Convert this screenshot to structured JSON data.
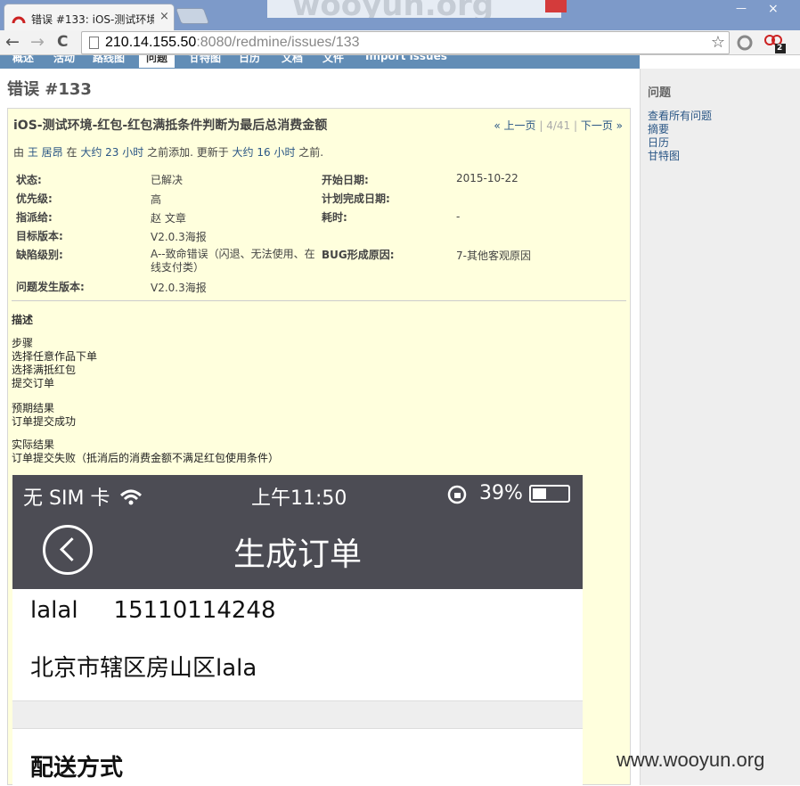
{
  "browser": {
    "tab_title": "错误 #133: iOS-测试环境",
    "tab_close": "×",
    "bg_logo_text": "wooyun.org",
    "minimize": "—",
    "close": "×",
    "url_host": "210.14.155.50",
    "url_rest": ":8080/redmine/issues/133",
    "nav_back": "←",
    "nav_forward": "→",
    "nav_reload": "C",
    "star": "☆",
    "ext_badge": "2"
  },
  "menu": [
    "概述",
    "活动",
    "路线图",
    "问题",
    "甘特图",
    "日历",
    "文档",
    "文件",
    "Import issues"
  ],
  "page": {
    "heading": "错误 #133"
  },
  "issue": {
    "subject": "iOS-测试环境-红包-红包满抵条件判断为最后总消费金额",
    "prev": "« 上一页",
    "position": "4/41",
    "next": "下一页 »",
    "by": "由",
    "author": "王 居昂",
    "at": "在",
    "created": "大约 23 小时",
    "added": "之前添加. 更新于",
    "updated": "大约 16 小时",
    "before": "之前.",
    "attributes": {
      "status_label": "状态:",
      "status": "已解决",
      "start_label": "开始日期:",
      "start": "2015-10-22",
      "priority_label": "优先级:",
      "priority": "高",
      "due_label": "计划完成日期:",
      "due": "",
      "assignee_label": "指派给:",
      "assignee": "赵 文章",
      "spent_label": "耗时:",
      "spent": "-",
      "target_label": "目标版本:",
      "target": "V2.0.3海报",
      "severity_label": "缺陷级别:",
      "severity": "A--致命错误（闪退、无法使用、在线支付类）",
      "cause_label": "BUG形成原因:",
      "cause": "7-其他客观原因",
      "found_label": "问题发生版本:",
      "found": "V2.0.3海报"
    },
    "description_title": "描述",
    "steps": [
      "步骤",
      "选择任意作品下单",
      "选择满抵红包",
      "提交订单"
    ],
    "expected": [
      "预期结果",
      "订单提交成功"
    ],
    "actual": [
      "实际结果",
      "订单提交失败（抵消后的消费金额不满足红包使用条件）"
    ]
  },
  "phone": {
    "carrier": "无 SIM 卡",
    "time": "上午11:50",
    "battery": "39%",
    "title": "生成订单",
    "name": "lalal",
    "phone_number": "15110114248",
    "address": "北京市辖区房山区lala",
    "section": "配送方式"
  },
  "sidebar": {
    "title": "问题",
    "links": [
      "查看所有问题",
      "摘要",
      "日历",
      "甘特图"
    ]
  },
  "watermark": "www.wooyun.org"
}
